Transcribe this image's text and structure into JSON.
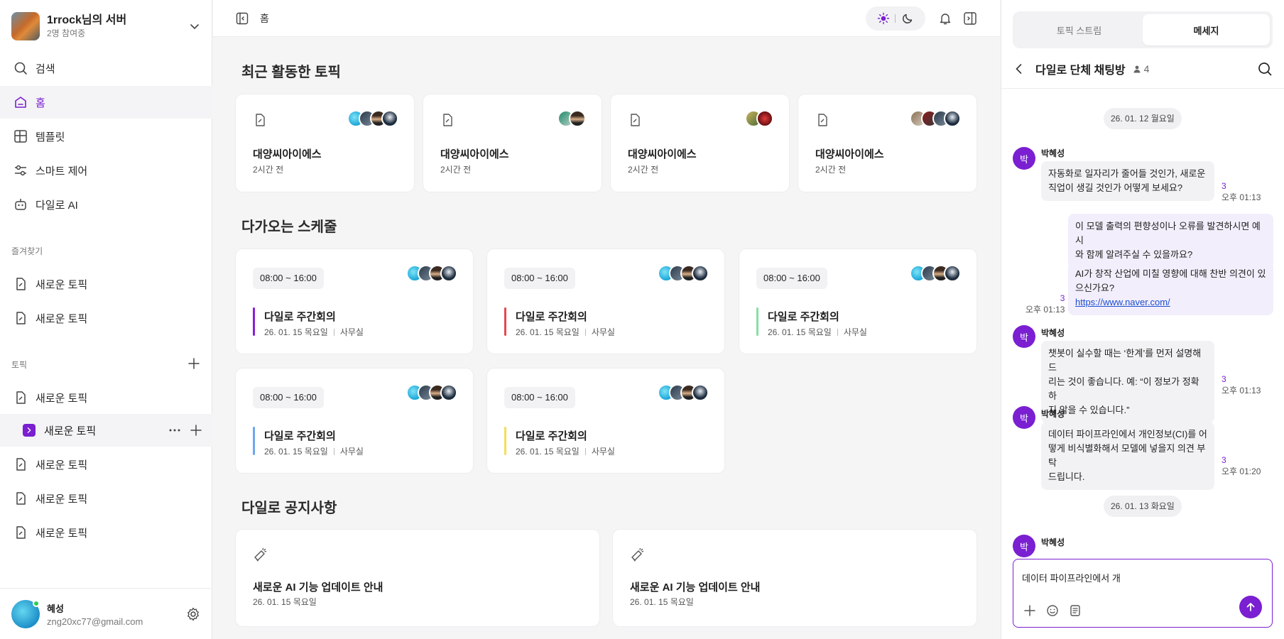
{
  "server": {
    "name": "1rrock님의 서버",
    "members": "2명 참여중"
  },
  "nav": {
    "search": "검색",
    "home": "홈",
    "template": "템플릿",
    "smart": "스마트 제어",
    "ai": "다일로 AI"
  },
  "favorites": {
    "label": "즐겨찾기",
    "items": [
      "새로운 토픽",
      "새로운 토픽"
    ]
  },
  "topics": {
    "label": "토픽",
    "items": [
      "새로운 토픽",
      "새로운 토픽",
      "새로운 토픽",
      "새로운 토픽",
      "새로운 토픽"
    ]
  },
  "profile": {
    "name": "혜성",
    "email": "zng20xc77@gmail.com"
  },
  "topbar": {
    "breadcrumb": "홈"
  },
  "recent": {
    "title": "최근 활동한 토픽",
    "cards": [
      {
        "title": "대양씨아이에스",
        "time": "2시간 전"
      },
      {
        "title": "대양씨아이에스",
        "time": "2시간 전"
      },
      {
        "title": "대양씨아이에스",
        "time": "2시간 전"
      },
      {
        "title": "대양씨아이에스",
        "time": "2시간 전"
      }
    ]
  },
  "schedule": {
    "title": "다가오는 스케줄",
    "cards": [
      {
        "time": "08:00 ~ 16:00",
        "title": "다일로 주간회의",
        "date": "26. 01. 15 목요일",
        "place": "사무실",
        "color": "#8a1fd6"
      },
      {
        "time": "08:00 ~ 16:00",
        "title": "다일로 주간회의",
        "date": "26. 01. 15 목요일",
        "place": "사무실",
        "color": "#e5484d"
      },
      {
        "time": "08:00 ~ 16:00",
        "title": "다일로 주간회의",
        "date": "26. 01. 15 목요일",
        "place": "사무실",
        "color": "#86e0a3"
      },
      {
        "time": "08:00 ~ 16:00",
        "title": "다일로 주간회의",
        "date": "26. 01. 15 목요일",
        "place": "사무실",
        "color": "#6aa8f0"
      },
      {
        "time": "08:00 ~ 16:00",
        "title": "다일로 주간회의",
        "date": "26. 01. 15 목요일",
        "place": "사무실",
        "color": "#f2e05a"
      }
    ]
  },
  "notice": {
    "title": "다일로 공지사항",
    "cards": [
      {
        "title": "새로운 AI 기능 업데이트 안내",
        "date": "26. 01. 15 목요일"
      },
      {
        "title": "새로운 AI 기능 업데이트 안내",
        "date": "26. 01. 15 목요일"
      }
    ]
  },
  "chat": {
    "tabs": [
      "토픽 스트림",
      "메세지"
    ],
    "room": "다일로 단체 채팅방",
    "member_count": "4",
    "dates": [
      "26. 01. 12 월요일",
      "26. 01. 13 화요일"
    ],
    "sender": "박혜성",
    "sender_initial": "박",
    "messages": [
      {
        "line1": "자동화로 일자리가 줄어들 것인가, 새로운",
        "line2": "직업이 생길 것인가 어떻게 보세요?",
        "read": "3",
        "time": "오후 01:13"
      },
      {
        "line1": "이 모델 출력의 편향성이나 오류를 발견하시면 예시",
        "line2": "와 함께 알려주실 수 있을까요?"
      },
      {
        "line1": "AI가 창작 산업에 미칠 영향에 대해 찬반 의견이 있",
        "line2": "으신가요?",
        "link": "https://www.naver.com/",
        "read": "3",
        "time": "오후 01:13"
      },
      {
        "line1": "챗봇이 실수할 때는 ‘한계’를 먼저 설명해 드",
        "line2": "리는 것이 좋습니다. 예: “이 정보가 정확하",
        "line3": "지 않을 수 있습니다.”",
        "read": "3",
        "time": "오후 01:13"
      },
      {
        "line1": "데이터 파이프라인에서 개인정보(CI)를 어",
        "line2": "떻게 비식별화해서 모델에 넣을지 의견 부탁",
        "line3": "드립니다.",
        "read": "3",
        "time": "오후 01:20"
      }
    ],
    "input_value": "데이터 파이프라인에서 개"
  }
}
